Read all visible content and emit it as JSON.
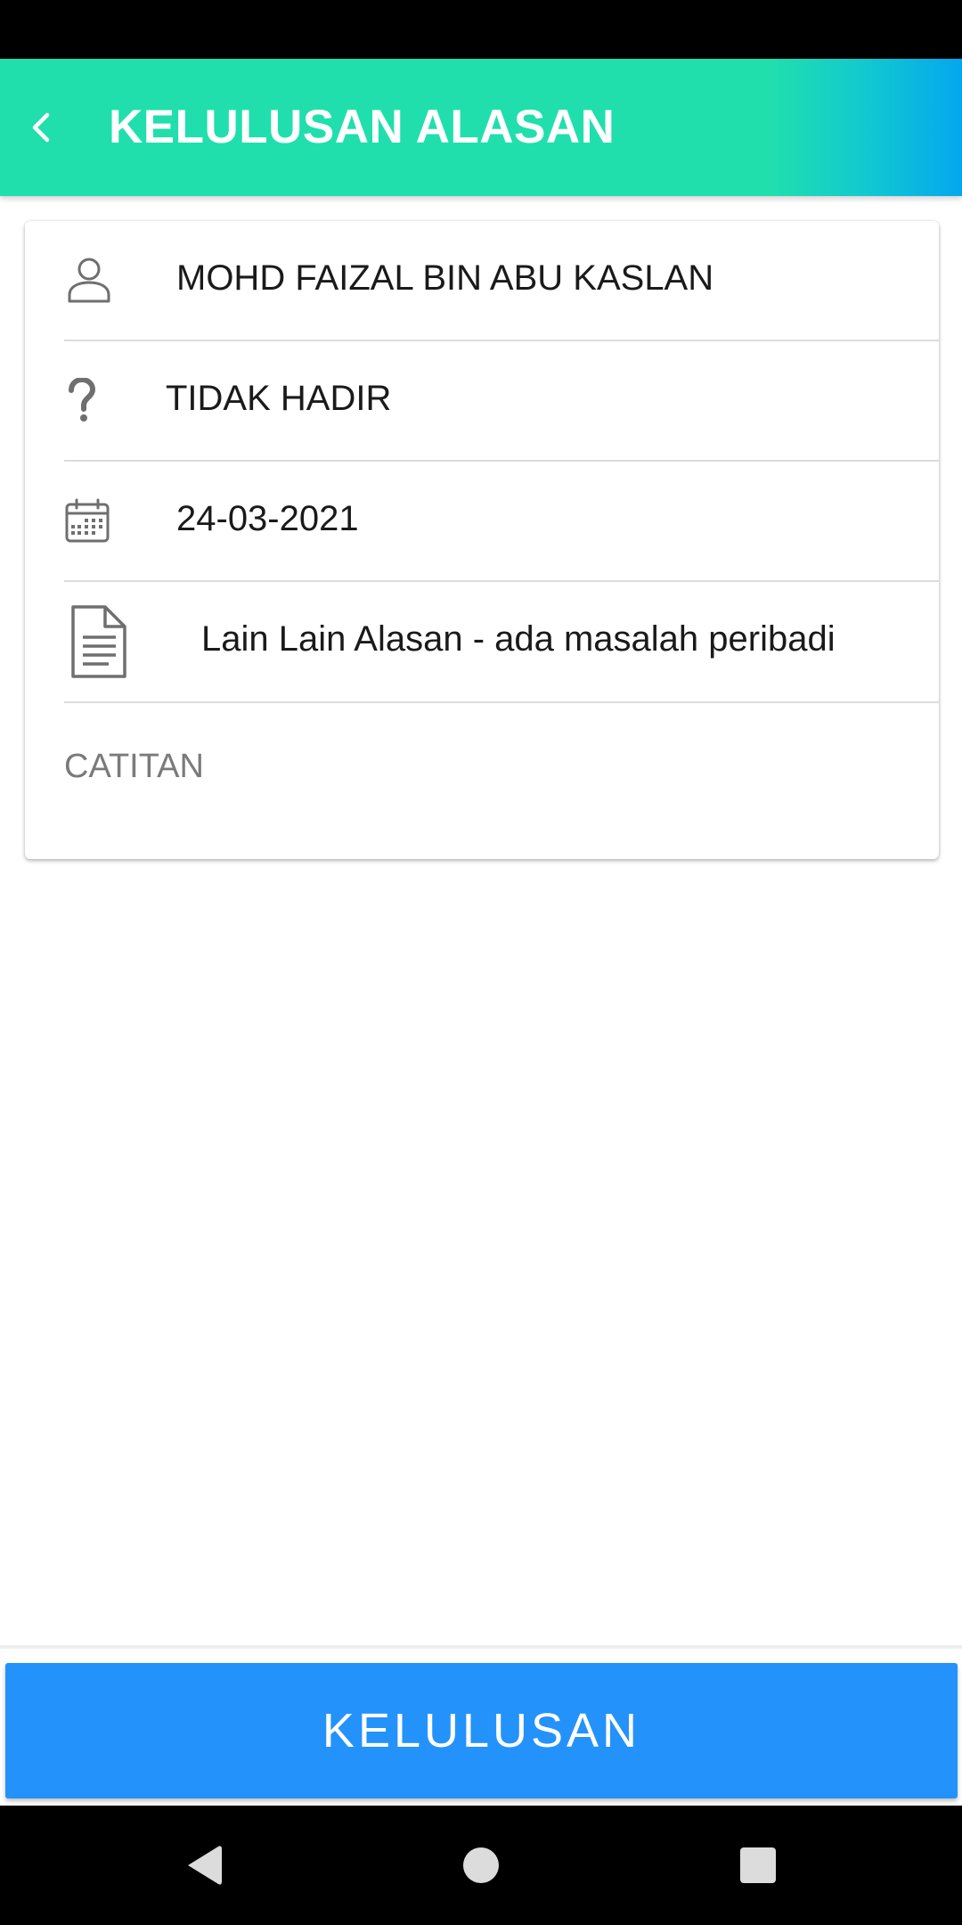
{
  "header": {
    "title": "KELULUSAN ALASAN",
    "back_icon": "chevron-left-icon",
    "gradient_start": "#20dfad",
    "gradient_end": "#03a7ee"
  },
  "details": {
    "name": "MOHD FAIZAL BIN ABU KASLAN",
    "name_icon": "person-icon",
    "status": "TIDAK HADIR",
    "status_icon": "question-mark-icon",
    "date": "24-03-2021",
    "date_icon": "calendar-icon",
    "reason": "Lain Lain Alasan - ada masalah peribadi",
    "reason_icon": "document-icon"
  },
  "note": {
    "placeholder": "CATITAN",
    "value": ""
  },
  "actions": {
    "approve_label": "KELULUSAN",
    "approve_color": "#2492fb"
  },
  "system_nav": {
    "back_icon": "triangle-back-icon",
    "home_icon": "circle-home-icon",
    "recents_icon": "square-recents-icon"
  }
}
